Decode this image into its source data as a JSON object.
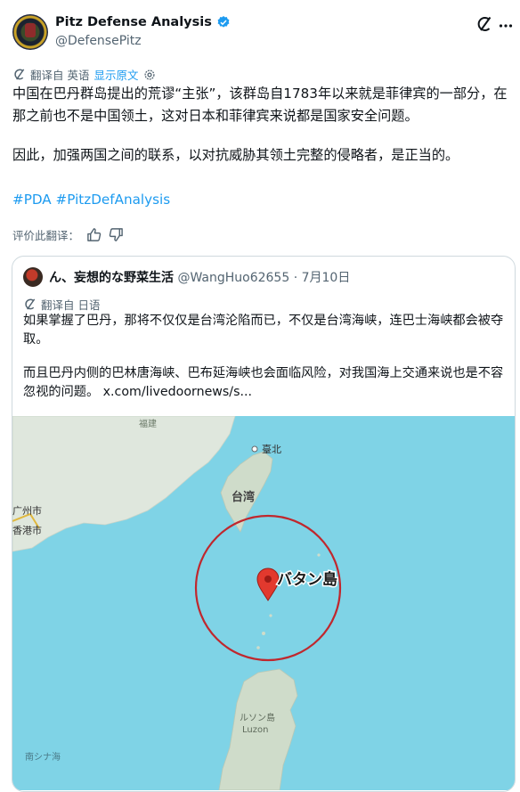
{
  "post": {
    "author_name": "Pitz Defense Analysis",
    "author_handle": "@DefensePitz",
    "translated_from": "翻译自 英语",
    "show_original": "显示原文",
    "paragraph1": "中国在巴丹群岛提出的荒谬“主张”，该群岛自1783年以来就是菲律宾的一部分，在那之前也不是中国领土，这对日本和菲律宾来说都是国家安全问题。",
    "paragraph2": "因此，加强两国之间的联系，以对抗威胁其领土完整的侵略者，是正当的。",
    "hashtag1": "#PDA",
    "hashtag2": "#PitzDefAnalysis",
    "rate_translation": "评价此翻译："
  },
  "quote": {
    "author_name": "ん、妄想的な野菜生活",
    "author_handle": "@WangHuo62655",
    "separator": "·",
    "date": "7月10日",
    "translated_from": "翻译自 日语",
    "paragraph1": "如果掌握了巴丹，那将不仅仅是台湾沦陷而已，不仅是台湾海峡，连巴士海峡都会被夺取。",
    "paragraph2": "而且巴丹内侧的巴林唐海峡、巴布延海峡也会面临风险，对我国海上交通来说也是不容忽视的问题。 x.com/livedoornews/s..."
  },
  "map": {
    "label_fujian": "福建",
    "label_taipei": "臺北",
    "label_taiwan": "台湾",
    "label_guangzhou": "广州市",
    "label_hongkong": "香港市",
    "label_batan": "バタン島",
    "label_luzon_jp": "ルソン島",
    "label_luzon": "Luzon",
    "label_scs": "南シナ海",
    "sea_color": "#7fd3e6",
    "land_color": "#dfe7dd",
    "circle_color": "#c0272d",
    "pin_color": "#e2392e"
  },
  "icons": [
    "verified-badge-icon",
    "grok-icon",
    "more-icon",
    "translate-icon",
    "settings-icon",
    "thumbs-up-icon",
    "thumbs-down-icon",
    "map-pin-icon"
  ]
}
